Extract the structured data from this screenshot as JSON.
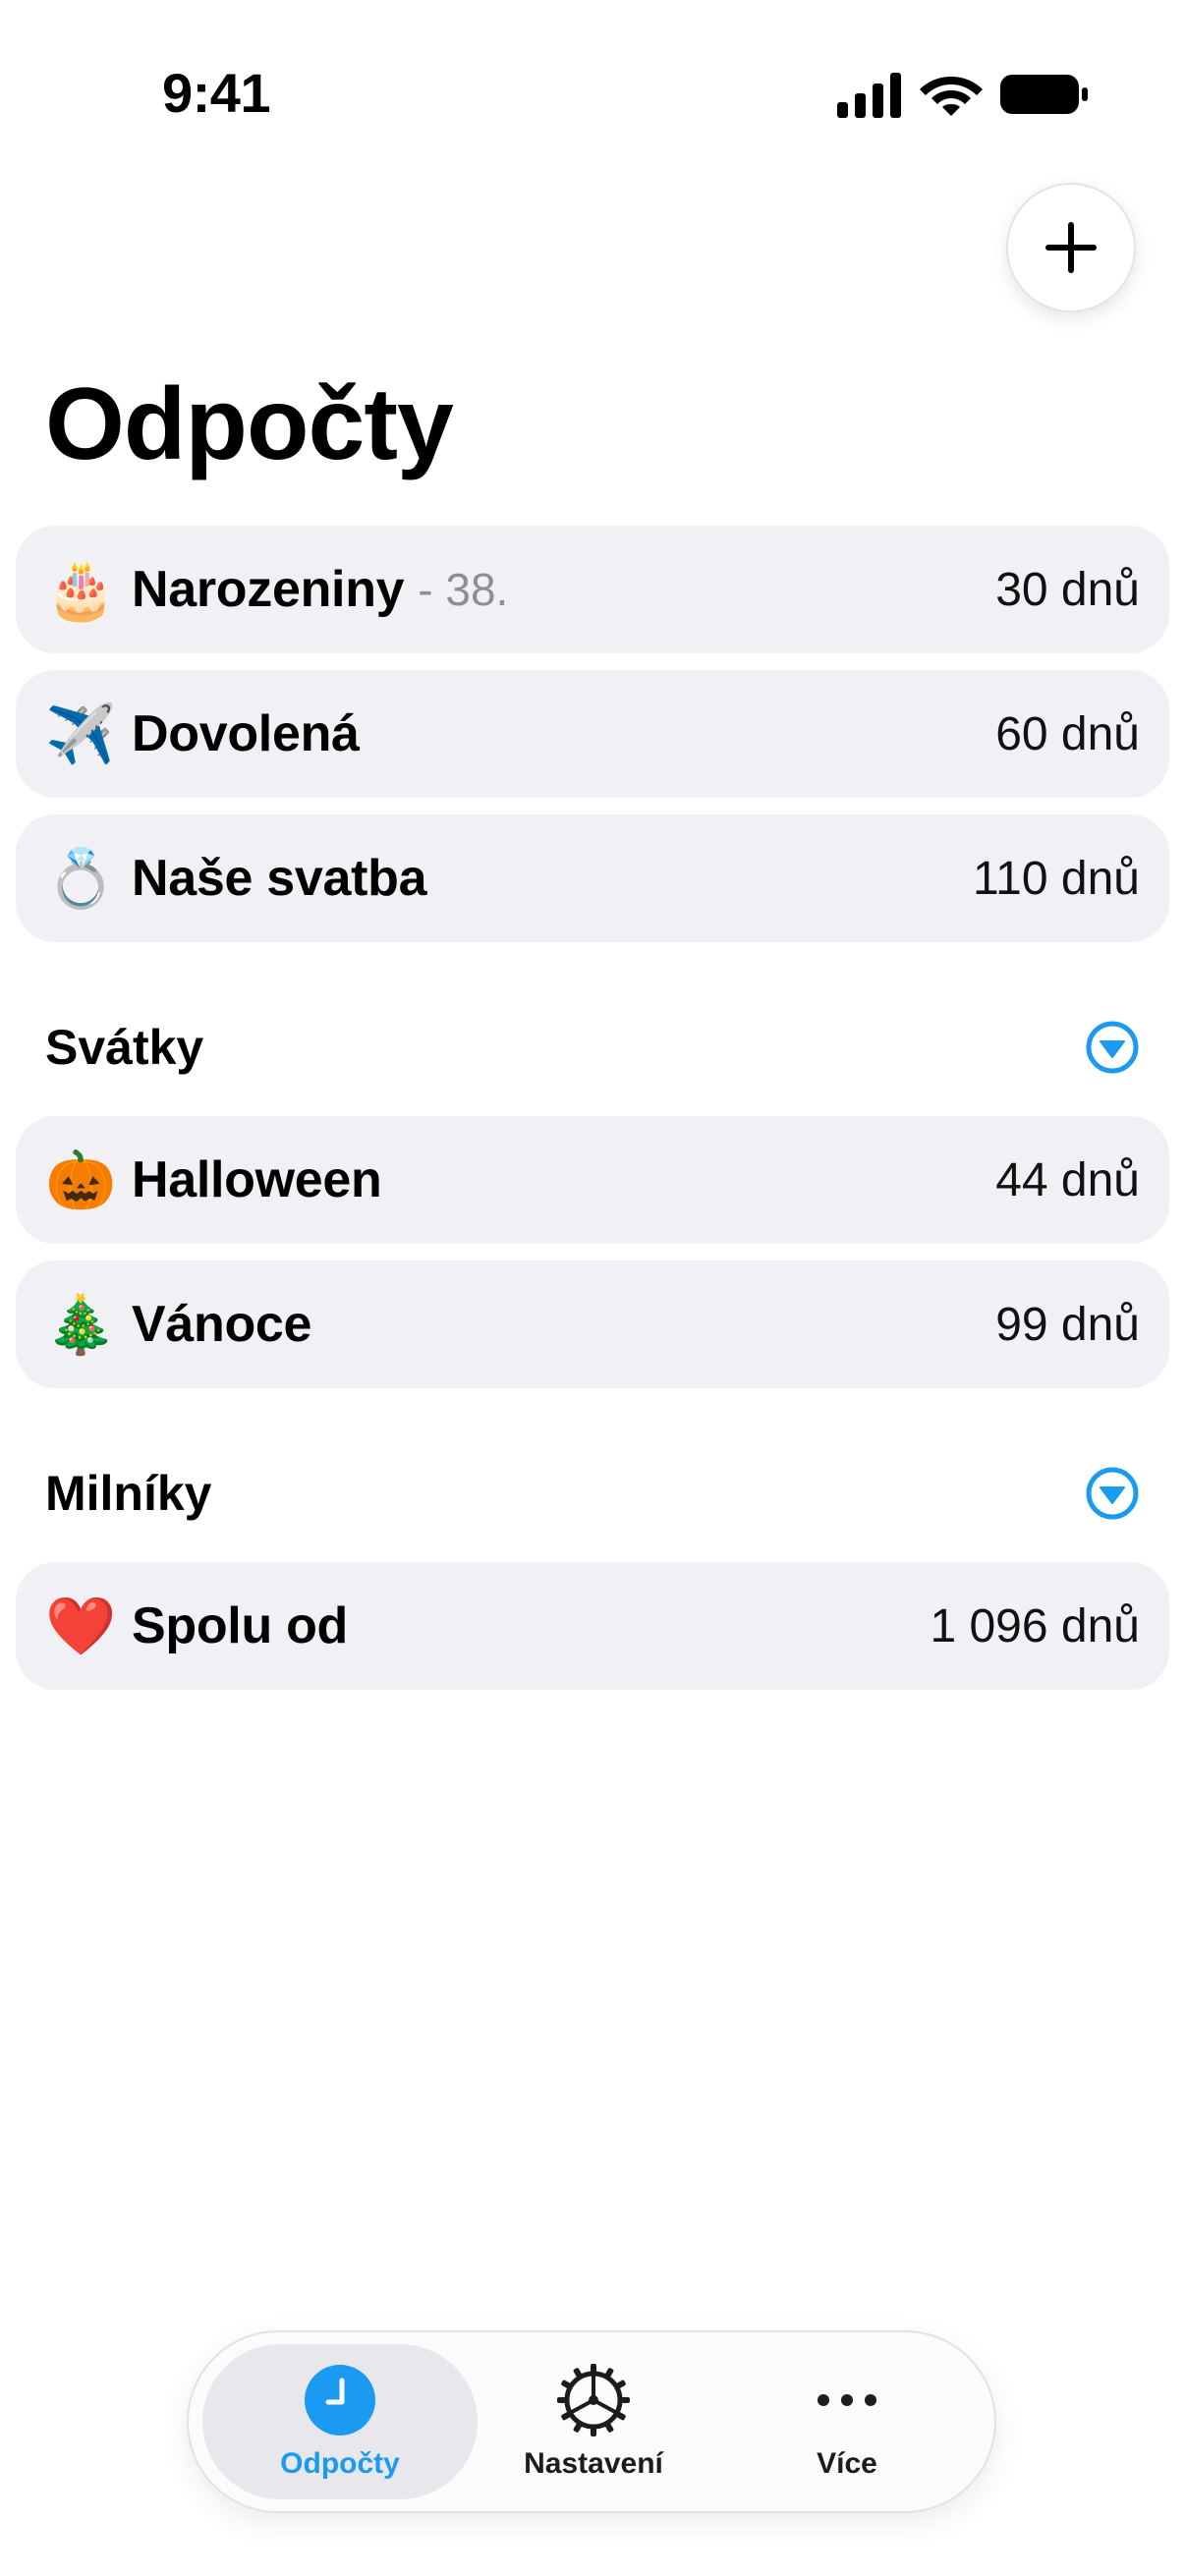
{
  "status_bar": {
    "time": "9:41",
    "icons": [
      "signal-icon",
      "wifi-icon",
      "battery-icon"
    ]
  },
  "header": {
    "title": "Odpočty",
    "add_icon": "plus-icon"
  },
  "countdowns": [
    {
      "emoji": "🎂",
      "title": "Narozeniny",
      "subtitle": "- 38.",
      "value": "30 dnů"
    },
    {
      "emoji": "✈️",
      "title": "Dovolená",
      "subtitle": "",
      "value": "60 dnů"
    },
    {
      "emoji": "💍",
      "title": "Naše svatba",
      "subtitle": "",
      "value": "110 dnů"
    }
  ],
  "holidays": {
    "title": "Svátky",
    "items": [
      {
        "emoji": "🎃",
        "title": "Halloween",
        "value": "44 dnů"
      },
      {
        "emoji": "🎄",
        "title": "Vánoce",
        "value": "99 dnů"
      }
    ]
  },
  "milestones": {
    "title": "Milníky",
    "items": [
      {
        "emoji": "❤️",
        "title": "Spolu od",
        "value": "1 096 dnů"
      }
    ]
  },
  "tab_bar": {
    "tabs": [
      {
        "label": "Odpočty",
        "icon": "clock-icon",
        "active": true
      },
      {
        "label": "Nastavení",
        "icon": "gear-icon",
        "active": false
      },
      {
        "label": "Více",
        "icon": "ellipsis-icon",
        "active": false
      }
    ]
  },
  "colors": {
    "accent": "#1a9af0",
    "row_background": "#f1f1f5",
    "secondary_text": "#8e8e93"
  }
}
